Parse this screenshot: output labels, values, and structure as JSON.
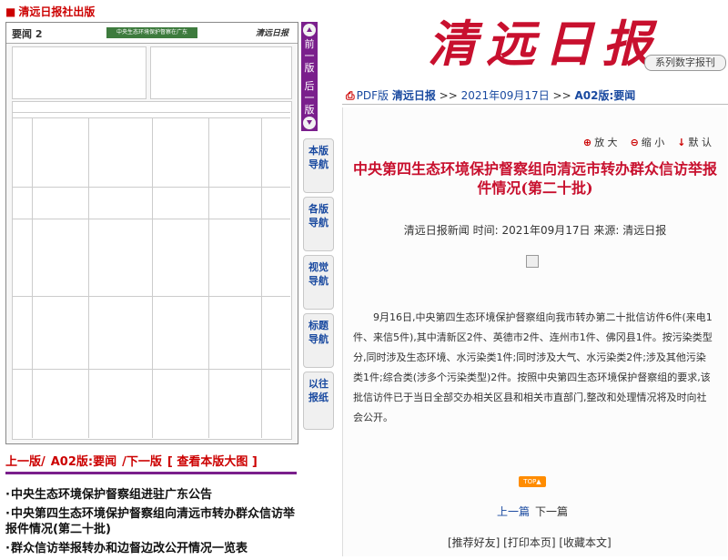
{
  "site": {
    "name": "清远日报社出版",
    "masthead": "清远日报",
    "series_tab": "系列数字报刊"
  },
  "paper_preview": {
    "section_label": "要闻",
    "section_no": "2",
    "headline_band": "中央生态环境保护督察在广东",
    "logo": "清远日报"
  },
  "page_strip": {
    "prev": "前一版",
    "next": "后一版"
  },
  "side_nav": [
    {
      "label": "本版导航"
    },
    {
      "label": "各版导航"
    },
    {
      "label": "视觉导航"
    },
    {
      "label": "标题导航"
    },
    {
      "label": "以往报纸"
    }
  ],
  "breadcrumb": {
    "pdf": "PDF版",
    "paper": "清远日报",
    "sep1": ">>",
    "date": "2021年09月17日",
    "sep2": ">>",
    "page": "A02版:要闻"
  },
  "tools": {
    "zoom_in": "放 大",
    "zoom_out": "缩 小",
    "default": "默 认"
  },
  "article": {
    "title": "中央第四生态环境保护督察组向清远市转办群众信访举报件情况(第二十批)",
    "meta": "清远日报新闻 时间: 2021年09月17日 来源: 清远日报",
    "body": "9月16日,中央第四生态环境保护督察组向我市转办第二十批信访件6件(来电1件、来信5件),其中清新区2件、英德市2件、连州市1件、佛冈县1件。按污染类型分,同时涉及生态环境、水污染类1件;同时涉及大气、水污染类2件;涉及其他污染类1件;综合类(涉多个污染类型)2件。按照中央第四生态环境保护督察组的要求,该批信访件已于当日全部交办相关区县和相关市直部门,整改和处理情况将及时向社会公开。"
  },
  "top_button": "TOP▲",
  "pager": {
    "prev": "上一篇",
    "next": "下一篇"
  },
  "actions": "[推荐好友] [打印本页] [收藏本文]",
  "bottom_bar": {
    "prev": "上一版/",
    "page": "A02版:要闻",
    "next": "/下一版",
    "view": "[ 查看本版大图 ]"
  },
  "left_list": [
    "中央生态环境保护督察组进驻广东公告",
    "中央第四生态环境保护督察组向清远市转办群众信访举报件情况(第二十批)",
    "群众信访举报转办和边督边改公开情况一览表"
  ],
  "colors": {
    "brand_red": "#c8102e",
    "nav_purple": "#7a1f8c",
    "link_blue": "#1a4aa0"
  }
}
